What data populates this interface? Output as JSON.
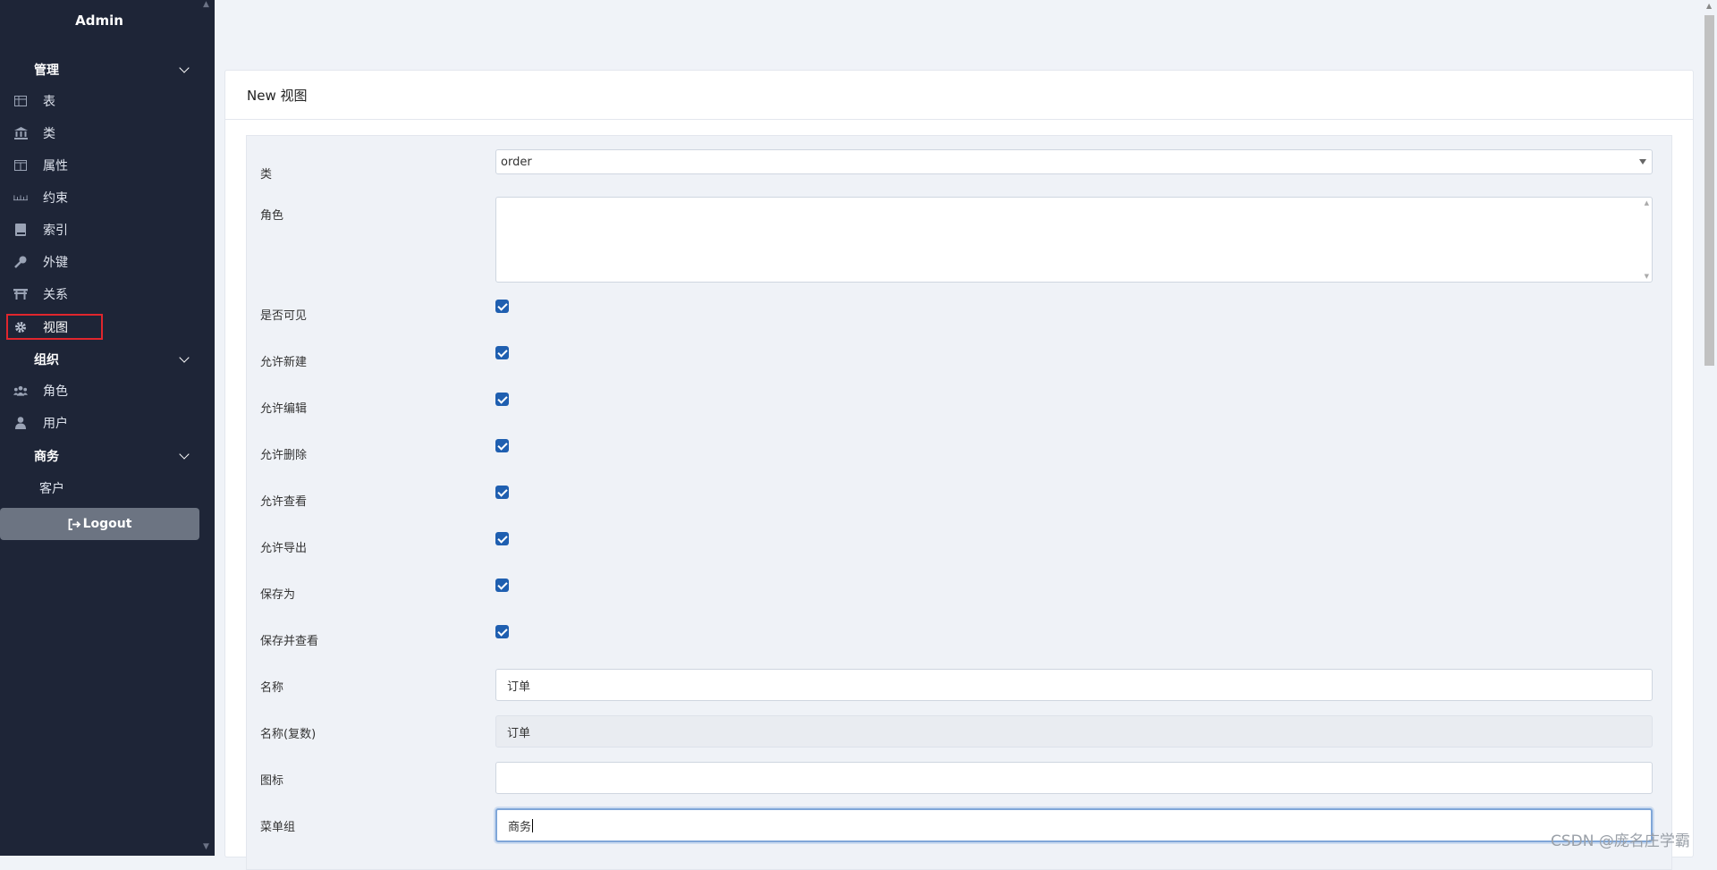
{
  "sidebar": {
    "brand": "Admin",
    "groups": [
      {
        "label": "管理"
      },
      {
        "label": "组织"
      },
      {
        "label": "商务"
      }
    ],
    "items": [
      {
        "label": "表",
        "icon": "table-icon"
      },
      {
        "label": "类",
        "icon": "bank-icon"
      },
      {
        "label": "属性",
        "icon": "columns-icon"
      },
      {
        "label": "约束",
        "icon": "ruler-icon"
      },
      {
        "label": "索引",
        "icon": "book-icon"
      },
      {
        "label": "外键",
        "icon": "key-icon"
      },
      {
        "label": "关系",
        "icon": "torii-icon"
      },
      {
        "label": "视图",
        "icon": "gear-icon",
        "active": true
      },
      {
        "label": "角色",
        "icon": "users-icon"
      },
      {
        "label": "用户",
        "icon": "user-icon"
      },
      {
        "label": "客户",
        "icon": ""
      }
    ],
    "logout": "Logout"
  },
  "main": {
    "title": "New 视图",
    "form": {
      "class_label": "类",
      "class_value": "order",
      "role_label": "角色",
      "role_value": "",
      "checkboxes": [
        {
          "label": "是否可见",
          "checked": true
        },
        {
          "label": "允许新建",
          "checked": true
        },
        {
          "label": "允许编辑",
          "checked": true
        },
        {
          "label": "允许删除",
          "checked": true
        },
        {
          "label": "允许查看",
          "checked": true
        },
        {
          "label": "允许导出",
          "checked": true
        },
        {
          "label": "保存为",
          "checked": true
        },
        {
          "label": "保存并查看",
          "checked": true
        }
      ],
      "name_label": "名称",
      "name_value": "订单",
      "plural_label": "名称(复数)",
      "plural_value": "订单",
      "icon_label": "图标",
      "icon_value": "",
      "menu_group_label": "菜单组",
      "menu_group_value": "商务"
    }
  },
  "watermark": "CSDN @庞名庄学霸",
  "colors": {
    "sidebar_bg": "#1e2537",
    "checkbox": "#1f5fb0",
    "active_outline": "#e0262d"
  }
}
